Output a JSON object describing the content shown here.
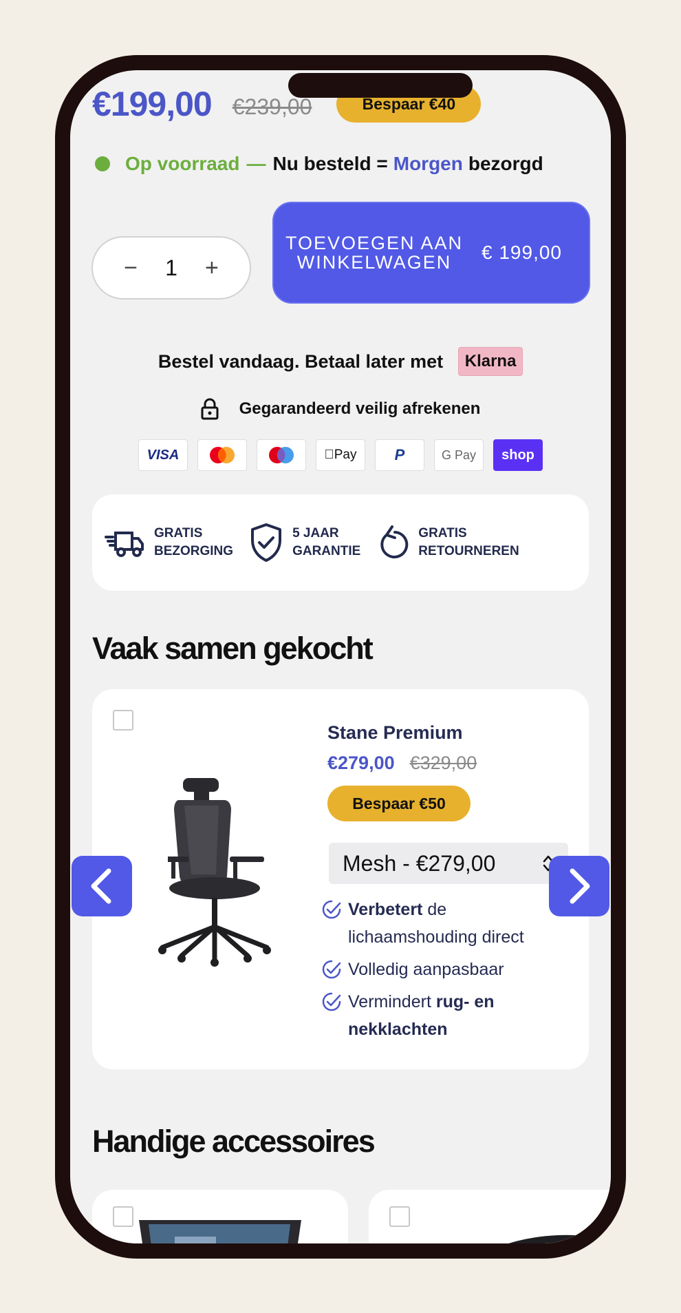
{
  "product": {
    "price": "€199,00",
    "old_price": "€239,00",
    "save_label": "Bespaar €40"
  },
  "stock": {
    "in_stock": "Op voorraad",
    "dash": "—",
    "text_before": "Nu besteld =",
    "highlight": "Morgen",
    "text_after": "bezorgd"
  },
  "quantity": {
    "minus": "−",
    "value": "1",
    "plus": "+"
  },
  "cart_button": {
    "label": "Toevoegen aan winkelwagen",
    "price": "€ 199,00"
  },
  "klarna": {
    "text": "Bestel vandaag. Betaal later met",
    "badge": "Klarna"
  },
  "secure": {
    "text": "Gegarandeerd veilig afrekenen"
  },
  "payment_methods": [
    {
      "name": "visa-icon",
      "label": "VISA"
    },
    {
      "name": "mastercard-icon",
      "label": ""
    },
    {
      "name": "maestro-icon",
      "label": ""
    },
    {
      "name": "apple-pay-icon",
      "label": "Pay"
    },
    {
      "name": "paypal-icon",
      "label": "P"
    },
    {
      "name": "google-pay-icon",
      "label": "G Pay"
    },
    {
      "name": "shop-pay-icon",
      "label": "shop"
    }
  ],
  "usps": [
    {
      "line1": "Gratis",
      "line2": "bezorging"
    },
    {
      "line1": "5 jaar",
      "line2": "garantie"
    },
    {
      "line1": "Gratis",
      "line2": "retourneren"
    }
  ],
  "fbt": {
    "title": "Vaak samen gekocht",
    "product": {
      "name": "Stane Premium",
      "price": "€279,00",
      "old_price": "€329,00",
      "save_label": "Bespaar €50",
      "variant": "Mesh - €279,00",
      "features": [
        {
          "bold": "Verbetert",
          "rest": " de lichaamshouding direct"
        },
        {
          "pre": "Volledig aanpasbaar"
        },
        {
          "pre": "Vermindert ",
          "bold": "rug- en nekklachten"
        }
      ]
    }
  },
  "accessories": {
    "title": "Handige accessoires"
  },
  "colors": {
    "accent": "#5159e6",
    "price_blue": "#4b56c7",
    "save_yellow": "#e7b12d",
    "stock_green": "#6cae3e"
  }
}
